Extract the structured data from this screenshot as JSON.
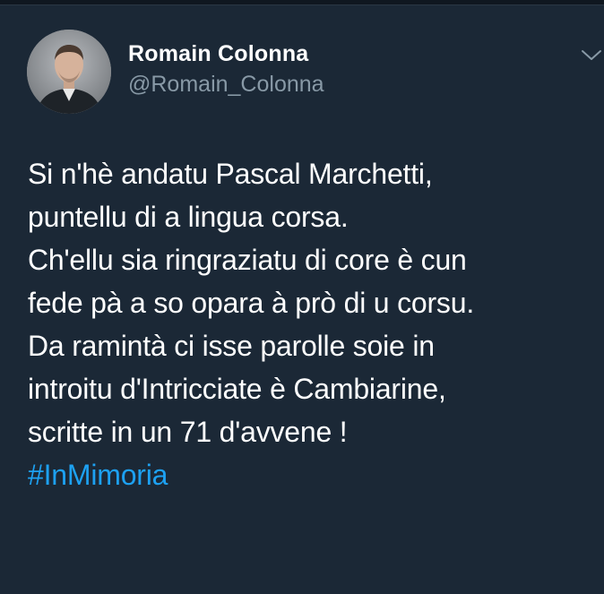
{
  "author": {
    "display_name": "Romain Colonna",
    "handle": "@Romain_Colonna",
    "avatar_icon": "profile-photo"
  },
  "menu": {
    "icon": "chevron-down-icon"
  },
  "tweet": {
    "lines": [
      "Si n'hè andatu Pascal Marchetti,",
      "puntellu di a lingua corsa.",
      "Ch'ellu sia ringraziatu di core è cun",
      "fede pà a so opara à prò di u corsu.",
      "Da ramintà ci isse parolle soie in",
      "introitu d'Intricciate è Cambiarine,",
      "scritte in un 71 d'avvene !"
    ],
    "hashtag": "#InMimoria"
  },
  "colors": {
    "background": "#1b2836",
    "text": "#ffffff",
    "secondary_text": "#8899a6",
    "link": "#1da1f2"
  }
}
